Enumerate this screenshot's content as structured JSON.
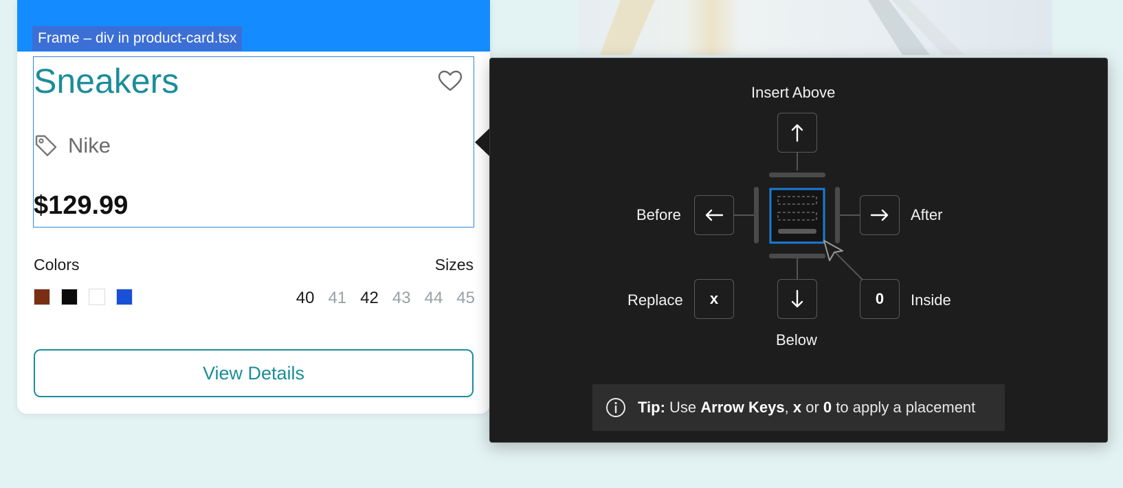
{
  "frame_label": "Frame – div in product-card.tsx",
  "product": {
    "title": "Sneakers",
    "brand": "Nike",
    "price": "$129.99",
    "colors_label": "Colors",
    "sizes_label": "Sizes",
    "colors": [
      "#7a2f12",
      "#0a0a0a",
      "#ffffff",
      "#1a4fd8"
    ],
    "sizes": [
      {
        "label": "40",
        "available": true
      },
      {
        "label": "41",
        "available": false
      },
      {
        "label": "42",
        "available": true
      },
      {
        "label": "43",
        "available": false
      },
      {
        "label": "44",
        "available": false
      },
      {
        "label": "45",
        "available": false
      }
    ],
    "view_details": "View Details"
  },
  "placement_menu": {
    "insert_above": "Insert Above",
    "before": "Before",
    "after": "After",
    "replace": "Replace",
    "replace_key": "x",
    "inside": "Inside",
    "inside_key": "0",
    "below": "Below",
    "tip_label": "Tip:",
    "tip_use": "Use",
    "tip_arrow_keys": "Arrow Keys",
    "tip_comma": ",",
    "tip_x": "x",
    "tip_or": "or",
    "tip_zero": "0",
    "tip_rest": "to apply a placement"
  },
  "colors": {
    "accent": "#1b8d9a",
    "topbar": "#148cff",
    "selection": "#1a7bd8",
    "popover_bg": "#1d1d1d"
  }
}
